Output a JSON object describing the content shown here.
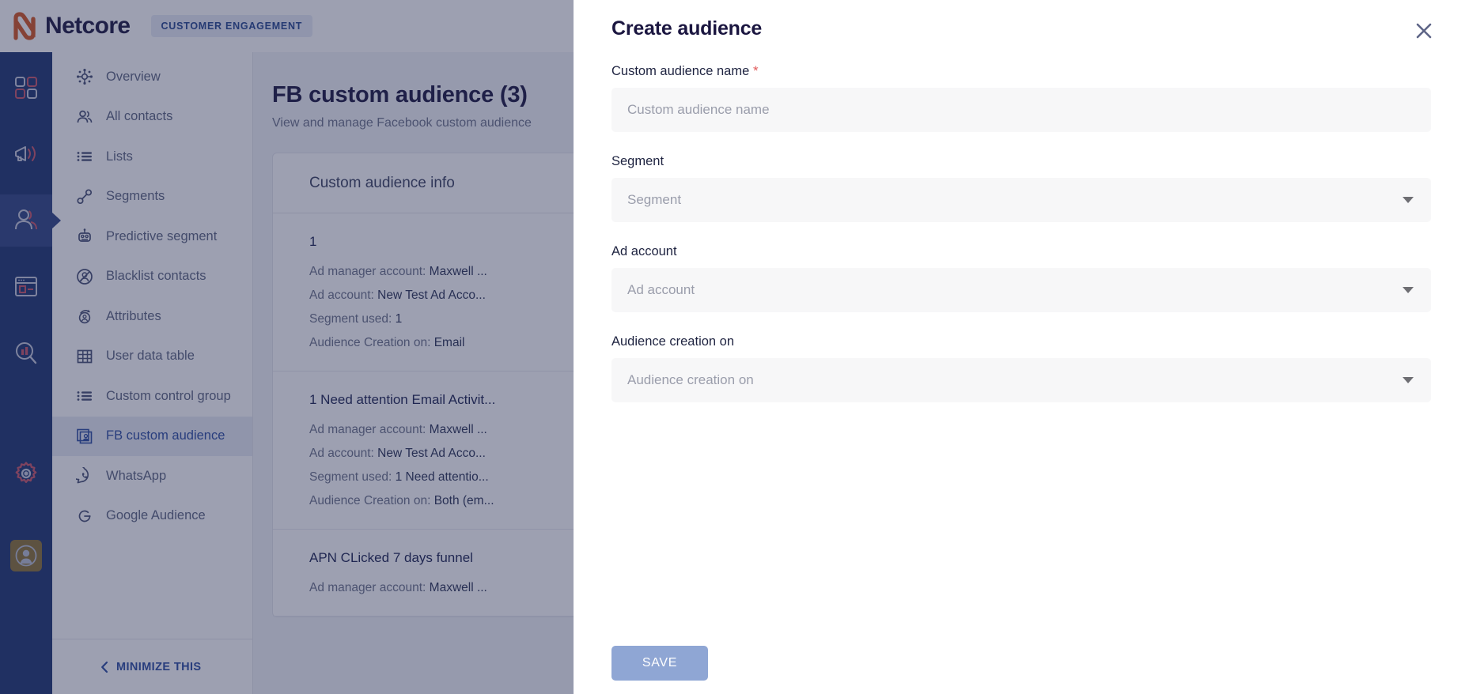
{
  "header": {
    "brand": "Netcore",
    "product_badge": "CUSTOMER ENGAGEMENT"
  },
  "icon_rail": {
    "items": [
      {
        "icon": "dashboard-grid-icon",
        "active": false
      },
      {
        "icon": "megaphone-icon",
        "active": false
      },
      {
        "icon": "contacts-people-icon",
        "active": true
      },
      {
        "icon": "browser-window-icon",
        "active": false
      },
      {
        "icon": "analytics-search-icon",
        "active": false
      }
    ],
    "gear": "gear-icon",
    "avatar": "user-avatar-icon"
  },
  "nav": {
    "items": [
      {
        "label": "Overview",
        "icon": "hub-network-icon",
        "active": false
      },
      {
        "label": "All contacts",
        "icon": "people-group-icon",
        "active": false
      },
      {
        "label": "Lists",
        "icon": "list-icon",
        "active": false
      },
      {
        "label": "Segments",
        "icon": "segment-node-icon",
        "active": false
      },
      {
        "label": "Predictive segment",
        "icon": "robot-icon",
        "active": false
      },
      {
        "label": "Blacklist contacts",
        "icon": "user-blocked-icon",
        "active": false
      },
      {
        "label": "Attributes",
        "icon": "attributes-icon",
        "active": false
      },
      {
        "label": "User data table",
        "icon": "table-grid-icon",
        "active": false
      },
      {
        "label": "Custom control group",
        "icon": "list-icon",
        "active": false
      },
      {
        "label": "FB custom audience",
        "icon": "id-card-stack-icon",
        "active": true
      },
      {
        "label": "WhatsApp",
        "icon": "whatsapp-icon",
        "active": false
      },
      {
        "label": "Google Audience",
        "icon": "google-icon",
        "active": false
      }
    ],
    "minimize_label": "MINIMIZE THIS"
  },
  "main": {
    "title": "FB custom audience (3)",
    "subtitle": "View and manage Facebook custom audience",
    "card_header": "Custom audience info",
    "audiences": [
      {
        "name": "1",
        "ad_manager_label": "Ad manager account:",
        "ad_manager_value": "Maxwell ...",
        "ad_account_label": "Ad account:",
        "ad_account_value": "New Test Ad Acco...",
        "segment_label": "Segment used:",
        "segment_value": "1",
        "creation_label": "Audience Creation on:",
        "creation_value": "Email"
      },
      {
        "name": "1 Need attention Email Activit...",
        "ad_manager_label": "Ad manager account:",
        "ad_manager_value": "Maxwell ...",
        "ad_account_label": "Ad account:",
        "ad_account_value": "New Test Ad Acco...",
        "segment_label": "Segment used:",
        "segment_value": "1 Need attentio...",
        "creation_label": "Audience Creation on:",
        "creation_value": "Both (em..."
      },
      {
        "name": "APN CLicked 7 days funnel",
        "ad_manager_label": "Ad manager account:",
        "ad_manager_value": "Maxwell ...",
        "ad_account_label": "Ad account:",
        "ad_account_value": "",
        "segment_label": "",
        "segment_value": "",
        "creation_label": "",
        "creation_value": ""
      }
    ]
  },
  "drawer": {
    "title": "Create audience",
    "close_icon": "close-x-icon",
    "fields": [
      {
        "label": "Custom audience name",
        "required": true,
        "placeholder": "Custom audience name",
        "type": "text"
      },
      {
        "label": "Segment",
        "required": false,
        "placeholder": "Segment",
        "type": "select"
      },
      {
        "label": "Ad account",
        "required": false,
        "placeholder": "Ad account",
        "type": "select"
      },
      {
        "label": "Audience creation on",
        "required": false,
        "placeholder": "Audience creation on",
        "type": "select"
      }
    ],
    "save_label": "SAVE"
  },
  "colors": {
    "rail_bg": "#1c3370",
    "rail_active": "#2e4483",
    "brand_orange": "#d4541f",
    "accent_blue": "#2a4ba0",
    "save_disabled": "#8fa6d4",
    "required_red": "#e05a5a"
  }
}
